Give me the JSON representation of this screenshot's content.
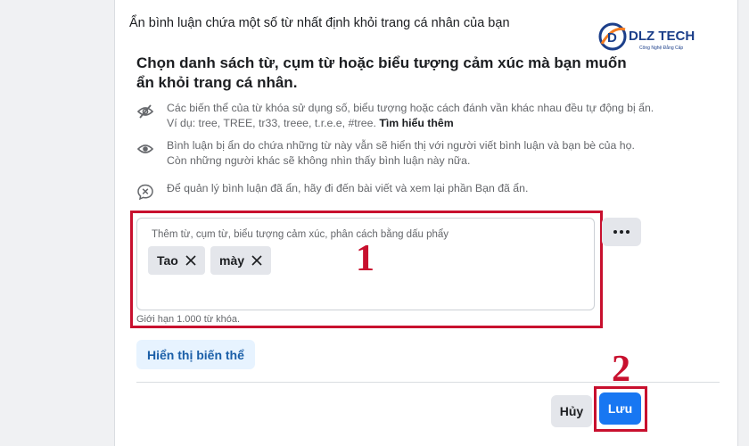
{
  "dialog": {
    "title": "Ẩn bình luận chứa một số từ nhất định khỏi trang cá nhân của bạn",
    "lead": "Chọn danh sách từ, cụm từ hoặc biểu tượng cảm xúc mà bạn muốn ẩn khỏi trang cá nhân."
  },
  "logo": {
    "brand": "DLZ TECH",
    "tagline": "Công Nghệ Đẳng Cấp",
    "colors": {
      "navy": "#1c3f8a",
      "orange": "#f47b20"
    }
  },
  "info": [
    {
      "icon": "eye-off-icon",
      "text": "Các biến thể của từ khóa sử dụng số, biểu tượng hoặc cách đánh vần khác nhau đều tự động bị ẩn. Ví dụ: tree, TREE, tr33, treee, t.r.e.e, #tree. ",
      "link": "Tìm hiểu thêm"
    },
    {
      "icon": "eye-icon",
      "text": "Bình luận bị ẩn do chứa những từ này vẫn sẽ hiển thị với người viết bình luận và bạn bè của họ. Còn những người khác sẽ không nhìn thấy bình luận này nữa."
    },
    {
      "icon": "comment-hidden-icon",
      "text": "Để quản lý bình luận đã ẩn, hãy đi đến bài viết và xem lại phần Bạn đã ẩn."
    }
  ],
  "keywords": {
    "placeholder": "Thêm từ, cụm từ, biểu tượng cảm xúc, phân cách bằng dấu phẩy",
    "chips": [
      "Tao",
      "mày"
    ],
    "limit": "Giới hạn 1.000 từ khóa."
  },
  "annotations": {
    "step1": "1",
    "step2": "2",
    "color": "#c8102e"
  },
  "buttons": {
    "more": "•••",
    "variants": "Hiển thị biến thể",
    "cancel": "Hủy",
    "save": "Lưu"
  },
  "colors": {
    "primary": "#1877f2",
    "secondary": "#e4e6eb",
    "highlight": "#c8102e"
  }
}
